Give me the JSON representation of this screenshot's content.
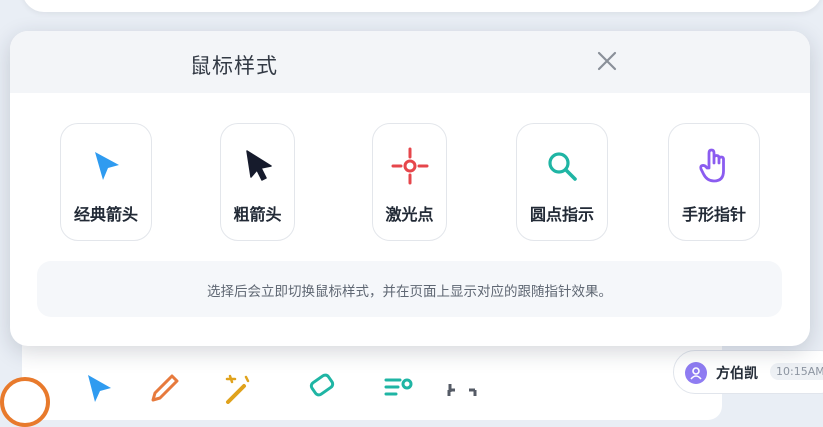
{
  "dialog": {
    "title": "鼠标样式",
    "close_icon": "close-icon",
    "options": [
      {
        "label": "经典箭头",
        "icon": "arrow-cursor-icon",
        "color": "#2f9bf0"
      },
      {
        "label": "粗箭头",
        "icon": "bold-arrow-cursor-icon",
        "color": "#161b2c"
      },
      {
        "label": "激光点",
        "icon": "laser-crosshair-icon",
        "color": "#e6464b"
      },
      {
        "label": "圆点指示",
        "icon": "magnifier-icon",
        "color": "#1fb5a4"
      },
      {
        "label": "手形指针",
        "icon": "hand-pointer-icon",
        "color": "#8b5cf0"
      }
    ],
    "hint": "选择后会立即切换鼠标样式，并在页面上显示对应的跟随指针效果。"
  },
  "user": {
    "name": "方伯凯",
    "time": "10:15AM",
    "avatar_color": "#8f7cf2"
  },
  "toolbar": {
    "tools": [
      "pointer-icon",
      "pen-icon",
      "magic-wand-icon",
      "eraser-icon",
      "text-list-icon",
      "fullscreen-icon"
    ]
  }
}
